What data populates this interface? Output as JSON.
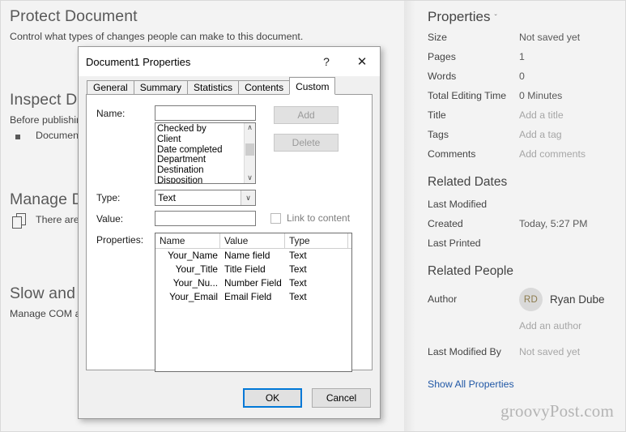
{
  "backstage": {
    "sections": [
      {
        "heading": "Protect Document",
        "description": "Control what types of changes people can make to this document."
      },
      {
        "heading": "Inspect Do",
        "description": "Before publishin",
        "bullet": "Document"
      },
      {
        "heading": "Manage D",
        "icon_text": "There are n"
      },
      {
        "heading": "Slow and D",
        "description": "Manage COM ad"
      }
    ]
  },
  "properties_pane": {
    "title": "Properties",
    "chevron": "ˇ",
    "rows": [
      {
        "label": "Size",
        "value": "Not saved yet",
        "dim": false
      },
      {
        "label": "Pages",
        "value": "1",
        "dim": false
      },
      {
        "label": "Words",
        "value": "0",
        "dim": false
      },
      {
        "label": "Total Editing Time",
        "value": "0 Minutes",
        "dim": false
      },
      {
        "label": "Title",
        "value": "Add a title",
        "dim": true
      },
      {
        "label": "Tags",
        "value": "Add a tag",
        "dim": true
      },
      {
        "label": "Comments",
        "value": "Add comments",
        "dim": true
      }
    ],
    "related_dates_heading": "Related Dates",
    "date_rows": [
      {
        "label": "Last Modified",
        "value": ""
      },
      {
        "label": "Created",
        "value": "Today, 5:27 PM"
      },
      {
        "label": "Last Printed",
        "value": ""
      }
    ],
    "related_people_heading": "Related People",
    "author_label": "Author",
    "author_initials": "RD",
    "author_name": "Ryan Dube",
    "add_author": "Add an author",
    "last_modified_by_label": "Last Modified By",
    "last_modified_by_value": "Not saved yet",
    "show_all_link": "Show All Properties",
    "watermark": "groovyPost.com"
  },
  "dialog": {
    "title": "Document1 Properties",
    "help_icon": "?",
    "close_icon": "✕",
    "tabs": [
      {
        "label": "General",
        "active": false
      },
      {
        "label": "Summary",
        "active": false
      },
      {
        "label": "Statistics",
        "active": false
      },
      {
        "label": "Contents",
        "active": false
      },
      {
        "label": "Custom",
        "active": true
      }
    ],
    "name_label": "Name:",
    "name_value": "",
    "name_suggestions": [
      "Checked by",
      "Client",
      "Date completed",
      "Department",
      "Destination",
      "Disposition"
    ],
    "scroll_up_arrow": "∧",
    "scroll_down_arrow": "∨",
    "add_button": "Add",
    "delete_button": "Delete",
    "type_label": "Type:",
    "type_value": "Text",
    "type_arrow": "∨",
    "value_label": "Value:",
    "value_value": "",
    "link_to_content": "Link to content",
    "properties_label": "Properties:",
    "grid_headers": [
      "Name",
      "Value",
      "Type"
    ],
    "grid_rows": [
      {
        "name": "Your_Name",
        "value": "Name field",
        "type": "Text"
      },
      {
        "name": "Your_Title",
        "value": "Title Field",
        "type": "Text"
      },
      {
        "name": "Your_Nu...",
        "value": "Number Field",
        "type": "Text"
      },
      {
        "name": "Your_Email",
        "value": "Email Field",
        "type": "Text"
      }
    ],
    "ok_button": "OK",
    "cancel_button": "Cancel"
  }
}
